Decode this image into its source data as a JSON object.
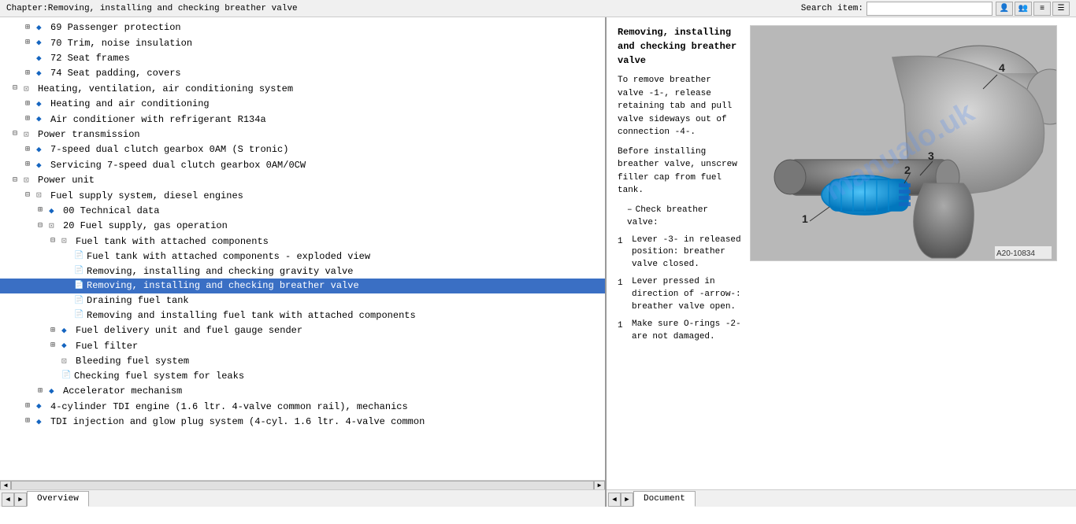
{
  "titleBar": {
    "title": "Chapter:Removing, installing and checking breather valve",
    "searchLabel": "Search item:",
    "searchPlaceholder": ""
  },
  "toolbar": {
    "icons": [
      "user-icon",
      "user2-icon",
      "menu-icon",
      "list-icon"
    ]
  },
  "tree": {
    "items": [
      {
        "id": 1,
        "indent": 2,
        "expand": "+",
        "icon": "blue-diamond",
        "text": "69 Passenger protection",
        "level": 2
      },
      {
        "id": 2,
        "indent": 2,
        "expand": "+",
        "icon": "blue-diamond",
        "text": "70 Trim, noise insulation",
        "level": 2
      },
      {
        "id": 3,
        "indent": 2,
        "expand": " ",
        "icon": "blue-diamond",
        "text": "72 Seat frames",
        "level": 2
      },
      {
        "id": 4,
        "indent": 2,
        "expand": "+",
        "icon": "blue-diamond",
        "text": "74 Seat padding, covers",
        "level": 2
      },
      {
        "id": 5,
        "indent": 1,
        "expand": "-",
        "icon": "folder-open",
        "text": "Heating, ventilation, air conditioning system",
        "level": 1
      },
      {
        "id": 6,
        "indent": 2,
        "expand": "+",
        "icon": "blue-diamond",
        "text": "Heating and air conditioning",
        "level": 2
      },
      {
        "id": 7,
        "indent": 2,
        "expand": "+",
        "icon": "blue-diamond",
        "text": "Air conditioner with refrigerant R134a",
        "level": 2
      },
      {
        "id": 8,
        "indent": 1,
        "expand": "-",
        "icon": "folder-open",
        "text": "Power transmission",
        "level": 1
      },
      {
        "id": 9,
        "indent": 2,
        "expand": "+",
        "icon": "blue-diamond",
        "text": "7-speed dual clutch gearbox 0AM (S tronic)",
        "level": 2
      },
      {
        "id": 10,
        "indent": 2,
        "expand": "+",
        "icon": "blue-diamond",
        "text": "Servicing 7-speed dual clutch gearbox 0AM/0CW",
        "level": 2
      },
      {
        "id": 11,
        "indent": 1,
        "expand": "-",
        "icon": "folder-open",
        "text": "Power unit",
        "level": 1
      },
      {
        "id": 12,
        "indent": 2,
        "expand": "-",
        "icon": "folder-open",
        "text": "Fuel supply system, diesel engines",
        "level": 2
      },
      {
        "id": 13,
        "indent": 3,
        "expand": "+",
        "icon": "blue-diamond",
        "text": "00 Technical data",
        "level": 3
      },
      {
        "id": 14,
        "indent": 3,
        "expand": "-",
        "icon": "folder-open",
        "text": "20 Fuel supply, gas operation",
        "level": 3
      },
      {
        "id": 15,
        "indent": 4,
        "expand": "-",
        "icon": "folder-open",
        "text": "Fuel tank with attached components",
        "level": 4
      },
      {
        "id": 16,
        "indent": 5,
        "expand": " ",
        "icon": "doc",
        "text": "Fuel tank with attached components - exploded view",
        "level": 5
      },
      {
        "id": 17,
        "indent": 5,
        "expand": " ",
        "icon": "doc",
        "text": "Removing, installing and checking gravity valve",
        "level": 5
      },
      {
        "id": 18,
        "indent": 5,
        "expand": " ",
        "icon": "doc",
        "text": "Removing, installing and checking breather valve",
        "level": 5,
        "selected": true
      },
      {
        "id": 19,
        "indent": 5,
        "expand": " ",
        "icon": "doc",
        "text": "Draining fuel tank",
        "level": 5
      },
      {
        "id": 20,
        "indent": 5,
        "expand": " ",
        "icon": "doc",
        "text": "Removing and installing fuel tank with attached components",
        "level": 5
      },
      {
        "id": 21,
        "indent": 4,
        "expand": "+",
        "icon": "blue-diamond",
        "text": "Fuel delivery unit and fuel gauge sender",
        "level": 4
      },
      {
        "id": 22,
        "indent": 4,
        "expand": "+",
        "icon": "blue-diamond",
        "text": "Fuel filter",
        "level": 4
      },
      {
        "id": 23,
        "indent": 4,
        "expand": " ",
        "icon": "folder-open",
        "text": "Bleeding fuel system",
        "level": 4
      },
      {
        "id": 24,
        "indent": 4,
        "expand": " ",
        "icon": "doc",
        "text": "Checking fuel system for leaks",
        "level": 4
      },
      {
        "id": 25,
        "indent": 3,
        "expand": "+",
        "icon": "blue-diamond",
        "text": "Accelerator mechanism",
        "level": 3
      },
      {
        "id": 26,
        "indent": 2,
        "expand": "+",
        "icon": "blue-diamond",
        "text": "4-cylinder TDI engine (1.6 ltr. 4-valve common rail), mechanics",
        "level": 2
      },
      {
        "id": 27,
        "indent": 2,
        "expand": "+",
        "icon": "blue-diamond",
        "text": "TDI injection and glow plug system (4-cyl. 1.6 ltr. 4-valve common",
        "level": 2
      }
    ]
  },
  "tabs": {
    "left": [
      {
        "label": "Overview",
        "active": true
      }
    ],
    "right": [
      {
        "label": "Document",
        "active": true
      }
    ]
  },
  "document": {
    "title": "Removing, installing and checking breather valve",
    "imageLabel": "A20-10834",
    "paragraphs": [
      {
        "type": "intro",
        "text": "To remove breather valve -1-, release retaining tab and pull valve sideways out of connection -4-."
      },
      {
        "type": "intro",
        "text": "Before installing breather valve, unscrew filler cap from fuel tank."
      },
      {
        "type": "heading",
        "text": "– Check breather valve:"
      },
      {
        "type": "step",
        "num": "1",
        "text": "Lever -3- in released position: breather valve closed."
      },
      {
        "type": "step",
        "num": "1",
        "text": "Lever pressed in direction of -arrow-: breather valve open."
      },
      {
        "type": "step",
        "num": "1",
        "text": "Make sure O-rings -2- are not damaged."
      }
    ],
    "watermark": "manualo.uk"
  }
}
